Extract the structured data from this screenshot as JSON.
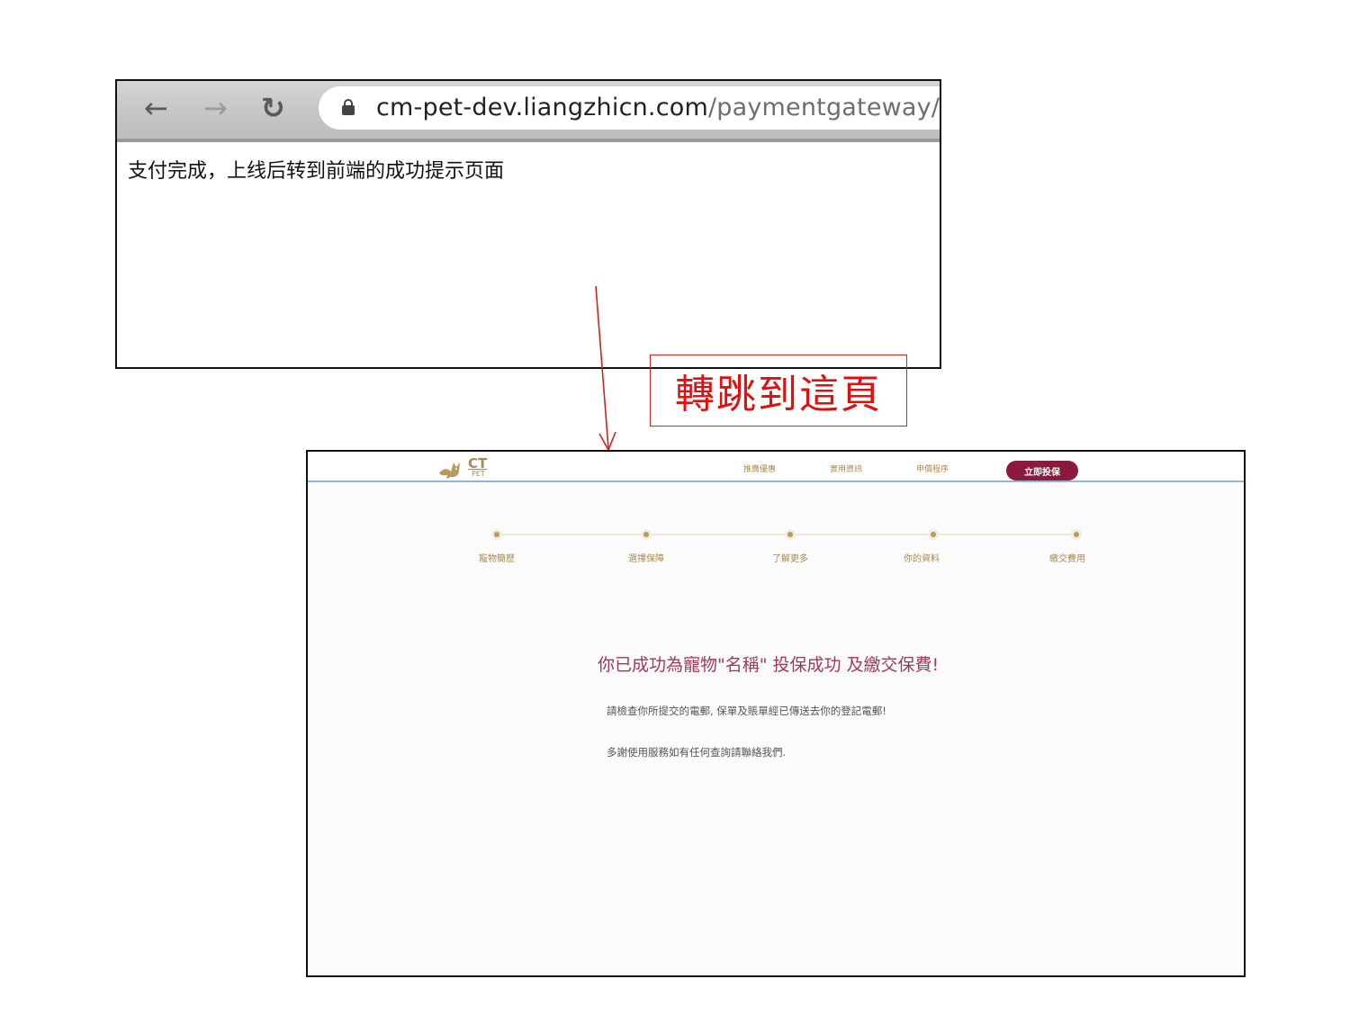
{
  "browser": {
    "url_host": "cm-pet-dev.liangzhicn.com",
    "url_path": "/paymentgateway/a",
    "page_message": "支付完成，上线后转到前端的成功提示页面",
    "icons": [
      "back-arrow-icon",
      "forward-arrow-icon",
      "reload-icon",
      "lock-icon"
    ]
  },
  "annotation": {
    "text": "轉跳到這頁",
    "color": "#e01010"
  },
  "site": {
    "logo": {
      "main": "CT",
      "sub": "PET"
    },
    "nav": [
      {
        "label": "推廣優惠"
      },
      {
        "label": "實用資訊"
      },
      {
        "label": "申償程序"
      }
    ],
    "cta_label": "立即投保",
    "colors": {
      "brand_gold": "#a88b54",
      "cta": "#8c1a3c",
      "title": "#a2385a"
    },
    "steps": [
      {
        "label": "寵物簡歷"
      },
      {
        "label": "選擇保障"
      },
      {
        "label": "了解更多"
      },
      {
        "label": "你的資料"
      },
      {
        "label": "繳交費用"
      }
    ],
    "success": {
      "title": "你已成功為寵物\"名稱\" 投保成功 及繳交保費!",
      "line1": "請檢查你所提交的電郵, 保單及賬單經已傳送去你的登記電郵!",
      "line2": "多謝使用服務如有任何查詢請聯絡我們."
    }
  }
}
